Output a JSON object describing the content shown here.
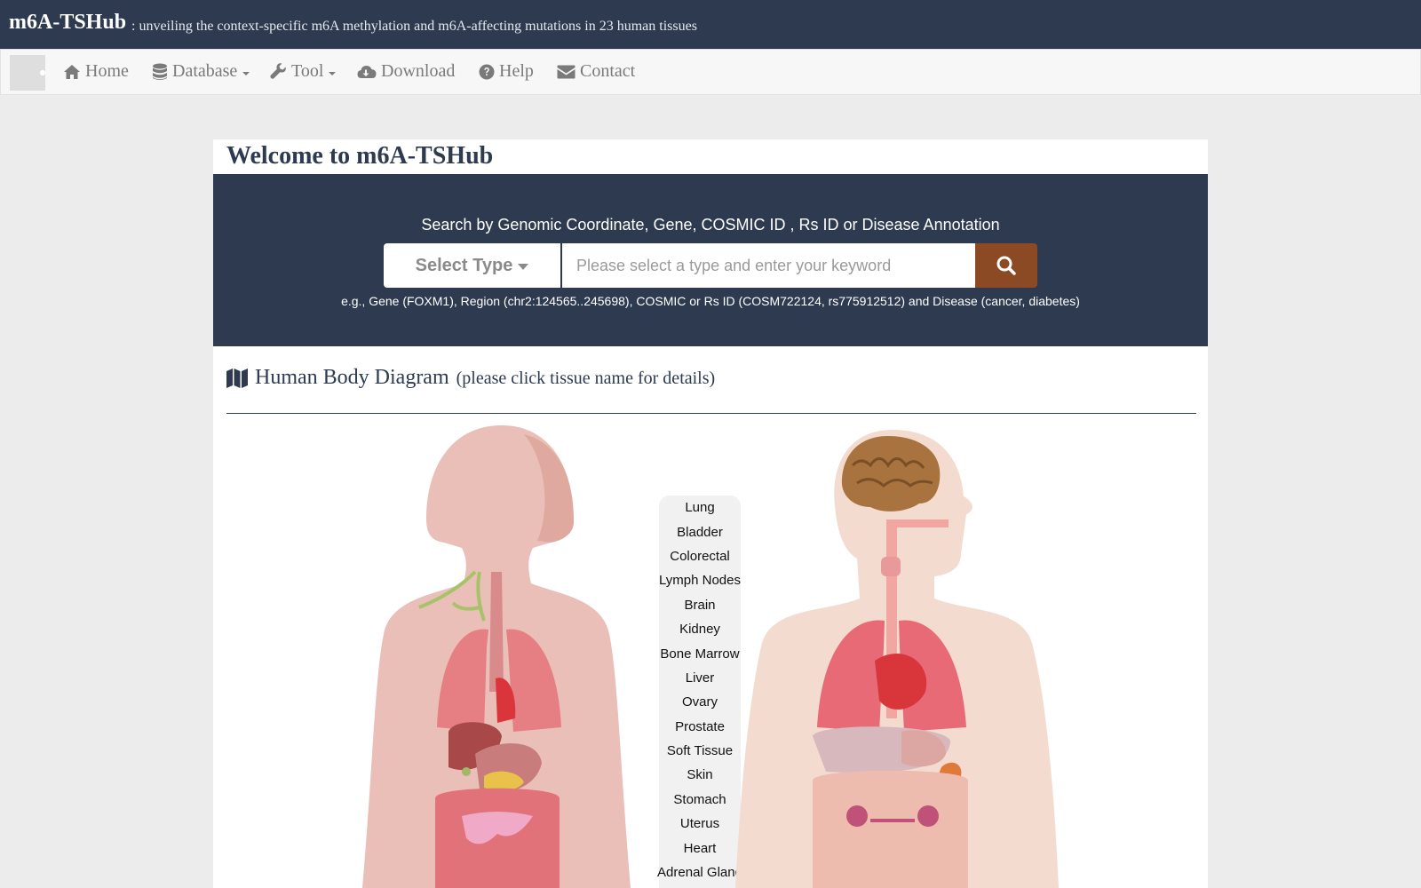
{
  "header": {
    "brand": "m6A-TSHub",
    "tagline": ": unveiling the context-specific m6A methylation and m6A-affecting mutations in 23 human tissues"
  },
  "nav": {
    "items": [
      {
        "label": "Home",
        "icon": "home-icon"
      },
      {
        "label": "Database",
        "icon": "database-icon",
        "dropdown": true
      },
      {
        "label": "Tool",
        "icon": "wrench-icon",
        "dropdown": true
      },
      {
        "label": "Download",
        "icon": "cloud-download-icon"
      },
      {
        "label": "Help",
        "icon": "question-circle-icon"
      },
      {
        "label": "Contact",
        "icon": "envelope-icon"
      }
    ]
  },
  "main": {
    "welcome": "Welcome to m6A-TSHub"
  },
  "search": {
    "title": "Search by Genomic Coordinate, Gene, COSMIC ID , Rs ID or Disease Annotation",
    "select_label": "Select Type",
    "placeholder": "Please select a type and enter your keyword",
    "value": "",
    "example": "e.g., Gene (FOXM1), Region (chr2:124565..245698), COSMIC or Rs ID (COSM722124, rs775912512) and Disease (cancer, diabetes)"
  },
  "diagram": {
    "title": "Human Body Diagram",
    "subtitle": "(please click tissue name for details)",
    "tissues": [
      "Lung",
      "Bladder",
      "Colorectal",
      "Lymph Nodes",
      "Brain",
      "Kidney",
      "Bone Marrow",
      "Liver",
      "Ovary",
      "Prostate",
      "Soft Tissue",
      "Skin",
      "Stomach",
      "Uterus",
      "Heart",
      "Adrenal Gland"
    ]
  },
  "colors": {
    "header_bg": "#2d3a50",
    "search_button": "#8c4a24",
    "page_bg": "#ececec"
  }
}
